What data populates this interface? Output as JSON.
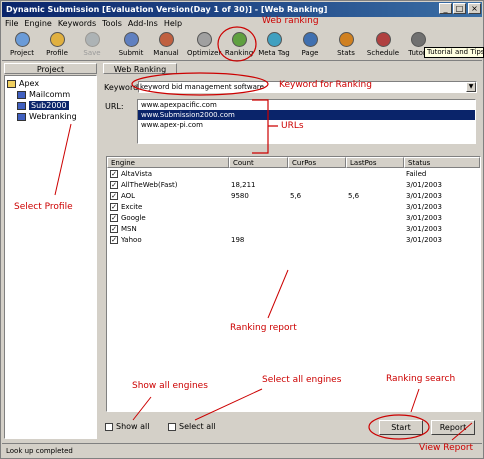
{
  "window": {
    "title": "Dynamic Submission [Evaluation Version(Day 1 of 30)] - [Web Ranking]",
    "min_label": "_",
    "max_label": "□",
    "close_label": "×"
  },
  "menu": [
    "File",
    "Engine",
    "Keywords",
    "Tools",
    "Add-Ins",
    "Help"
  ],
  "toolbar": {
    "project": "Project",
    "profile": "Profile",
    "save": "Save",
    "submit": "Submit",
    "manual": "Manual",
    "optimizer": "Optimizer",
    "ranking": "Ranking",
    "meta_tag": "Meta Tag",
    "page": "Page",
    "stats": "Stats",
    "schedule": "Schedule",
    "tutorial": "Tutori",
    "tooltip": "Tutorial and Tips"
  },
  "left_pane": {
    "header": "Project",
    "tree": [
      "Apex",
      "Mailcomm",
      "Sub2000",
      "Webranking"
    ],
    "selected": "Sub2000"
  },
  "right_pane": {
    "header": "Web Ranking",
    "keyword_label": "Keyword:",
    "keyword_value": "keyword bid management software",
    "url_label": "URL:",
    "urls": [
      "www.apexpacific.com",
      "www.Submission2000.com",
      "www.apex-pi.com"
    ],
    "selected_url": "www.Submission2000.com"
  },
  "table": {
    "columns": [
      "Engine",
      "Count",
      "CurPos",
      "LastPos",
      "Status"
    ],
    "rows": [
      {
        "engine": "AltaVista",
        "count": "",
        "curpos": "",
        "lastpos": "",
        "status": "Failed"
      },
      {
        "engine": "AllTheWeb(Fast)",
        "count": "18,211",
        "curpos": "",
        "lastpos": "",
        "status": "3/01/2003"
      },
      {
        "engine": "AOL",
        "count": "9580",
        "curpos": "5,6",
        "lastpos": "5,6",
        "status": "3/01/2003"
      },
      {
        "engine": "Excite",
        "count": "",
        "curpos": "",
        "lastpos": "",
        "status": "3/01/2003"
      },
      {
        "engine": "Google",
        "count": "",
        "curpos": "",
        "lastpos": "",
        "status": "3/01/2003"
      },
      {
        "engine": "MSN",
        "count": "",
        "curpos": "",
        "lastpos": "",
        "status": "3/01/2003"
      },
      {
        "engine": "Yahoo",
        "count": "198",
        "curpos": "",
        "lastpos": "",
        "status": "3/01/2003"
      }
    ]
  },
  "bottom": {
    "show_all": "Show all",
    "select_all": "Select all",
    "start": "Start",
    "report": "Report"
  },
  "statusbar": "Look up completed",
  "annotations": {
    "web_ranking": "Web ranking",
    "keyword_for_ranking": "Keyword for Ranking",
    "urls": "URLs",
    "select_profile": "Select Profile",
    "ranking_report": "Ranking report",
    "show_all_engines": "Show all engines",
    "select_all_engines": "Select all engines",
    "ranking_search": "Ranking search",
    "view_report": "View Report"
  },
  "colors": {
    "title_bar": "#0a246a",
    "selection": "#0a246a",
    "annotation": "#cc0000",
    "face": "#d4d0c8"
  }
}
